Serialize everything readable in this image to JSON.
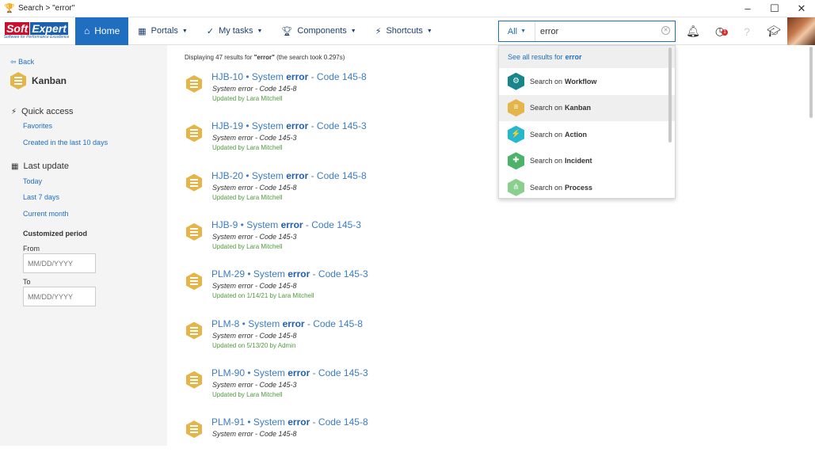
{
  "window": {
    "title": "Search > \"error\"",
    "min": "–",
    "max": "☐",
    "close": "✕"
  },
  "nav": {
    "logo_a": "Soft",
    "logo_b": "Expert",
    "logo_tag": "Software for Performance Excellence",
    "home": "Home",
    "portals": "Portals",
    "mytasks": "My tasks",
    "components": "Components",
    "shortcuts": "Shortcuts"
  },
  "search": {
    "scope": "All",
    "value": "error"
  },
  "dropdown": {
    "see_all": "See all results for",
    "term": "error",
    "prefix": "Search on",
    "items": [
      {
        "label": "Workflow",
        "color": "#16868a",
        "icon": "gears-icon"
      },
      {
        "label": "Kanban",
        "color": "#e6b54a",
        "icon": "kanban-icon"
      },
      {
        "label": "Action",
        "color": "#23b7d0",
        "icon": "lightning-icon"
      },
      {
        "label": "Incident",
        "color": "#4bb36a",
        "icon": "cross-icon"
      },
      {
        "label": "Process",
        "color": "#8bcf8f",
        "icon": "process-icon"
      }
    ]
  },
  "sidebar": {
    "back": "Back",
    "title": "Kanban",
    "quick_access": "Quick access",
    "favorites": "Favorites",
    "created": "Created in the last 10 days",
    "last_update": "Last update",
    "today": "Today",
    "last7": "Last 7 days",
    "month": "Current month",
    "customized": "Customized period",
    "from": "From",
    "to": "To",
    "date_placeholder": "MM/DD/YYYY"
  },
  "main": {
    "displaying": "Displaying 47 results for",
    "query": "\"error\"",
    "took": "(the search took 0.297s)",
    "results": [
      {
        "id": "HJB-10 • System ",
        "kw": "error",
        "code": " - Code 145-8",
        "sub": "System error - Code 145-8",
        "upd": "Updated by Lara Mitchell"
      },
      {
        "id": "HJB-19 • System ",
        "kw": "error",
        "code": " - Code 145-3",
        "sub": "System error - Code 145-3",
        "upd": "Updated by Lara Mitchell"
      },
      {
        "id": "HJB-20 • System ",
        "kw": "error",
        "code": " - Code 145-8",
        "sub": "System error - Code 145-8",
        "upd": "Updated by Lara Mitchell"
      },
      {
        "id": "HJB-9 • System ",
        "kw": "error",
        "code": " - Code 145-3",
        "sub": "System error - Code 145-3",
        "upd": "Updated by Lara Mitchell"
      },
      {
        "id": "PLM-29 • System ",
        "kw": "error",
        "code": " - Code 145-3",
        "sub": "System error - Code 145-8",
        "upd": "Updated on 1/14/21 by Lara Mitchell"
      },
      {
        "id": "PLM-8 • System ",
        "kw": "error",
        "code": " - Code 145-8",
        "sub": "System error - Code 145-8",
        "upd": "Updated on 5/13/20 by Admin"
      },
      {
        "id": "PLM-90 • System ",
        "kw": "error",
        "code": " - Code 145-3",
        "sub": "System error - Code 145-3",
        "upd": "Updated by Lara Mitchell"
      },
      {
        "id": "PLM-91 • System ",
        "kw": "error",
        "code": " - Code 145-8",
        "sub": "System error - Code 145-8",
        "upd": ""
      }
    ]
  }
}
